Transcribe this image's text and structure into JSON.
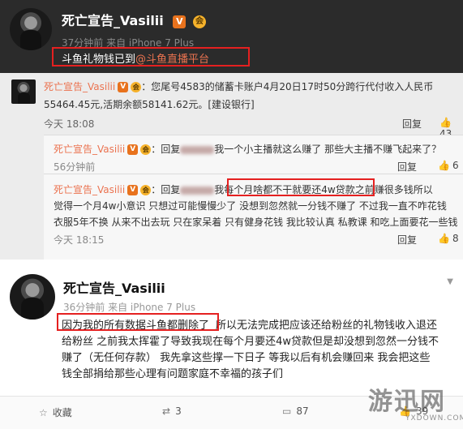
{
  "post1": {
    "author": "死亡宣告_Vasilii",
    "verified_badge": "V",
    "member_badge": "会",
    "meta": "37分钟前 来自 iPhone 7 Plus",
    "content_prefix": "斗鱼礼物钱已到",
    "mention": "@斗鱼直播平台"
  },
  "repost": {
    "author": "死亡宣告_Vasilii",
    "text_line1": "：您尾号4583的储蓄卡账户4月20日17时50分跨行代付收入人民币",
    "text_line2": "55464.45元,活期余额58141.62元。[建设银行]",
    "time": "今天 18:08",
    "reply_label": "回复",
    "like_count": "43",
    "nested": [
      {
        "author": "死亡宣告_Vasilii",
        "reply_prefix": "：回复",
        "text": "我一个小主播就这么赚了 那些大主播不赚飞起来了？",
        "time": "56分钟前",
        "reply_label": "回复",
        "like_count": "6"
      },
      {
        "author": "死亡宣告_Vasilii",
        "reply_prefix": "：回复",
        "text_highlight": "我每个月啥都不干就要还4w贷款",
        "text_rest": "之前赚很多钱所以",
        "line2": "觉得一个月4w小意识 只想过可能慢慢少了 没想到忽然就一分钱不赚了 不过我一直不咋花钱",
        "line3": "衣服5年不换 从来不出去玩 只在家呆着 只有健身花钱 我比较认真 私教课 和吃上面要花一些钱",
        "time": "今天 18:15",
        "reply_label": "回复",
        "like_count": "8"
      }
    ]
  },
  "post2": {
    "author": "死亡宣告_Vasilii",
    "verified_badge": "V",
    "member_badge": "会",
    "meta": "36分钟前 来自 iPhone 7 Plus",
    "highlight": "因为我的所有数据斗鱼都删除了",
    "line1_rest": "所以无法完成把应该还给粉丝的礼物钱收入退还",
    "line2": "给粉丝 之前我太挥霍了导致我现在每个月要还4w贷款但是却没想到忽然一分钱不",
    "line3": "赚了（无任何存款） 我先拿这些撑一下日子  等我以后有机会赚回来 我会把这些",
    "line4": "钱全部捐给那些心理有问题家庭不幸福的孩子们"
  },
  "actions": {
    "favorite_label": "收藏",
    "repost_count": "3",
    "comment_count": "87",
    "like_count": "39"
  },
  "watermark": {
    "main": "游迅网",
    "sub": "YXDOWN.COM"
  }
}
